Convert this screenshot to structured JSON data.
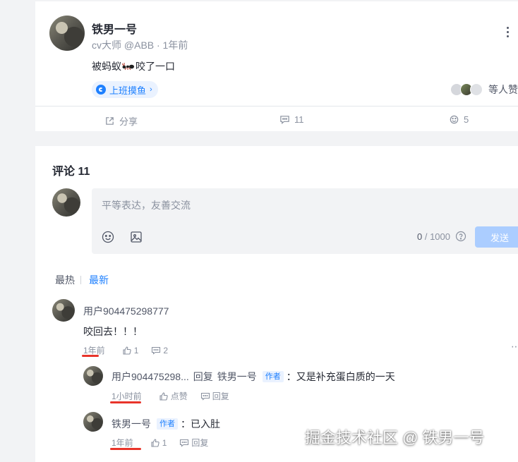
{
  "post": {
    "author": "铁男一号",
    "meta": "cv大师 @ABB · 1年前",
    "content_before": "被蚂蚁",
    "content_after": "咬了一口",
    "topic_tag": "上班摸鱼",
    "likers_text": "等人赞",
    "actions": {
      "share": "分享",
      "comment_count": "11",
      "like_count": "5"
    }
  },
  "comments": {
    "title": "评论 11",
    "editor": {
      "placeholder": "平等表达，友善交流",
      "count_current": "0",
      "count_max": " / 1000",
      "send_label": "发送"
    },
    "sort": {
      "hot": "最热",
      "latest": "最新"
    },
    "items": [
      {
        "user": "用户904475298777",
        "text": "咬回去！！！",
        "time": "1年前",
        "likes": "1",
        "replies": "2"
      }
    ],
    "replies": [
      {
        "user": "用户904475298...",
        "reply_word": "回复",
        "reply_to": "铁男一号",
        "author_tag": "作者",
        "text": "：又是补充蛋白质的一天",
        "time": "1小时前",
        "like_label": "点赞",
        "reply_label": "回复"
      },
      {
        "user": "铁男一号",
        "author_tag": "作者",
        "text": "：已入肚",
        "time": "1年前",
        "likes": "1",
        "reply_label": "回复"
      }
    ]
  },
  "watermark": "掘金技术社区 @ 铁男一号",
  "colors": {
    "brand": "#1e80ff",
    "send_disabled": "#abcdff",
    "annotation": "#e8342a"
  }
}
